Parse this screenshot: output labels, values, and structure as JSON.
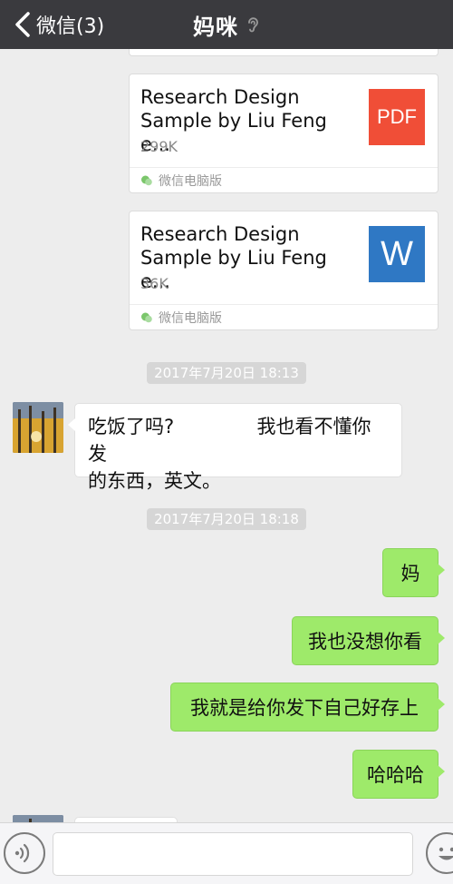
{
  "header": {
    "back_label": "微信(3)",
    "title": "妈咪"
  },
  "messages": {
    "file1": {
      "name": "Research Design\nSample by Liu Feng e...",
      "size": "299K",
      "icon_label": "PDF",
      "source": "微信电脑版"
    },
    "file2": {
      "name": "Research Design\nSample by Liu Feng e...",
      "size": "36K",
      "icon_label": "W",
      "source": "微信电脑版"
    },
    "timestamp1": "2017年7月20日 18:13",
    "incoming1_line1_a": "吃饭了吗?",
    "incoming1_line1_b": "我也看不懂你发",
    "incoming1_line2": "的东西，英文。",
    "timestamp2": "2017年7月20日 18:18",
    "outgoing1": "妈",
    "outgoing2": "我也没想你看",
    "outgoing3": "我就是给你发下自己好存上",
    "outgoing4": "哈哈哈"
  },
  "colors": {
    "header_bg": "#3a3a3e",
    "chat_bg": "#ededed",
    "outgoing_bubble": "#9eea6a",
    "incoming_bubble": "#ffffff",
    "pdf_icon": "#f04e37",
    "word_icon": "#2f78c4"
  },
  "icons": {
    "back": "chevron-left-icon",
    "title_badge": "ear-icon",
    "voice": "voice-icon",
    "emoji": "emoji-icon",
    "file_source": "wechat-icon"
  }
}
